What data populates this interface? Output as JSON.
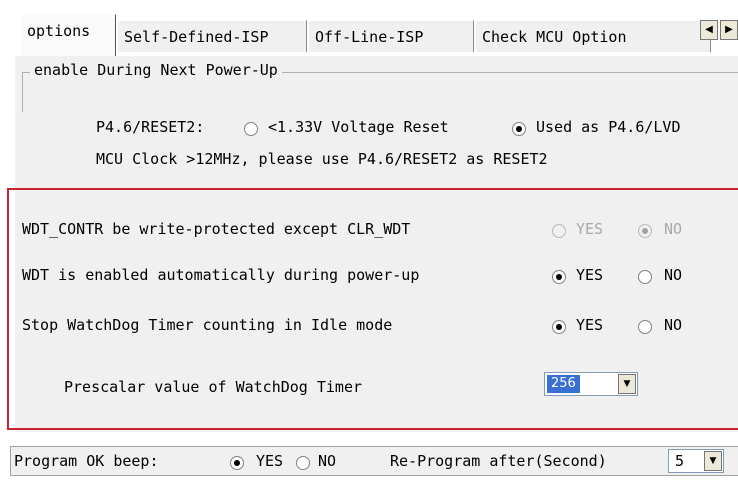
{
  "tabs": [
    {
      "label": "options",
      "active": true
    },
    {
      "label": "Self-Defined-ISP",
      "active": false
    },
    {
      "label": "Off-Line-ISP",
      "active": false
    },
    {
      "label": "Check MCU Option",
      "active": false
    }
  ],
  "tab_scroll": {
    "left_icon": "◀",
    "right_icon": "▶"
  },
  "group": {
    "label": "enable During Next Power-Up"
  },
  "reset": {
    "label": "P4.6/RESET2:",
    "option1": "<1.33V Voltage Reset",
    "option2": "Used as P4.6/LVD",
    "selected": "option2",
    "note": "MCU Clock >12MHz, please use P4.6/RESET2 as RESET2"
  },
  "wdt": {
    "protect": {
      "label": "WDT_CONTR be write-protected except CLR_WDT",
      "yes": "YES",
      "no": "NO",
      "selected": "no",
      "disabled": true
    },
    "auto_enable": {
      "label": "WDT is enabled automatically during power-up",
      "yes": "YES",
      "no": "NO",
      "selected": "yes"
    },
    "idle_stop": {
      "label": "Stop WatchDog Timer counting in Idle mode",
      "yes": "YES",
      "no": "NO",
      "selected": "yes"
    },
    "prescalar": {
      "label": "Prescalar value of WatchDog Timer",
      "value": "256"
    }
  },
  "bottom": {
    "beep_label": "Program OK beep:",
    "yes": "YES",
    "no": "NO",
    "selected": "yes",
    "reprogram_label": "Re-Program after(Second)",
    "reprogram_value": "5"
  },
  "colors": {
    "highlight": "#c5262f",
    "selection": "#3a6fd4",
    "panel": "#f0f0f0"
  }
}
